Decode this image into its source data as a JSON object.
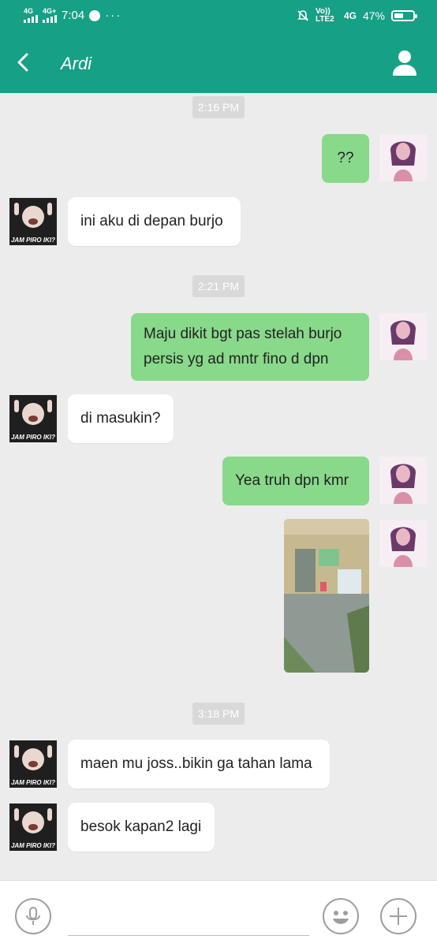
{
  "status_bar": {
    "net1": "4G",
    "net2": "4G+",
    "time": "7:04",
    "more": "···",
    "volte": "Vo)) LTE2",
    "net3": "4G",
    "battery": "47%"
  },
  "header": {
    "contact_name": "Ardi"
  },
  "avatar_caption": "JAM PIRO IKI?",
  "timestamps": [
    "2:16 PM",
    "2:21 PM",
    "3:18 PM"
  ],
  "messages": [
    {
      "from": "me",
      "lines": [
        "??"
      ]
    },
    {
      "from": "contact",
      "lines": [
        "ini aku di depan burjo"
      ]
    },
    {
      "from": "me",
      "lines": [
        "Maju dikit bgt pas stelah burjo",
        "persis yg ad mntr fino d dpn"
      ]
    },
    {
      "from": "contact",
      "lines": [
        "di masukin?"
      ]
    },
    {
      "from": "me",
      "lines": [
        "Yea truh dpn kmr"
      ]
    },
    {
      "from": "me",
      "type": "photo"
    },
    {
      "from": "contact",
      "lines": [
        "maen mu joss..bikin ga tahan lama"
      ]
    },
    {
      "from": "contact",
      "lines": [
        "besok kapan2 lagi"
      ]
    }
  ],
  "colors": {
    "brand": "#16a085",
    "outgoing_bubble": "#89d98b",
    "incoming_bubble": "#ffffff",
    "chat_background": "#ececec"
  }
}
